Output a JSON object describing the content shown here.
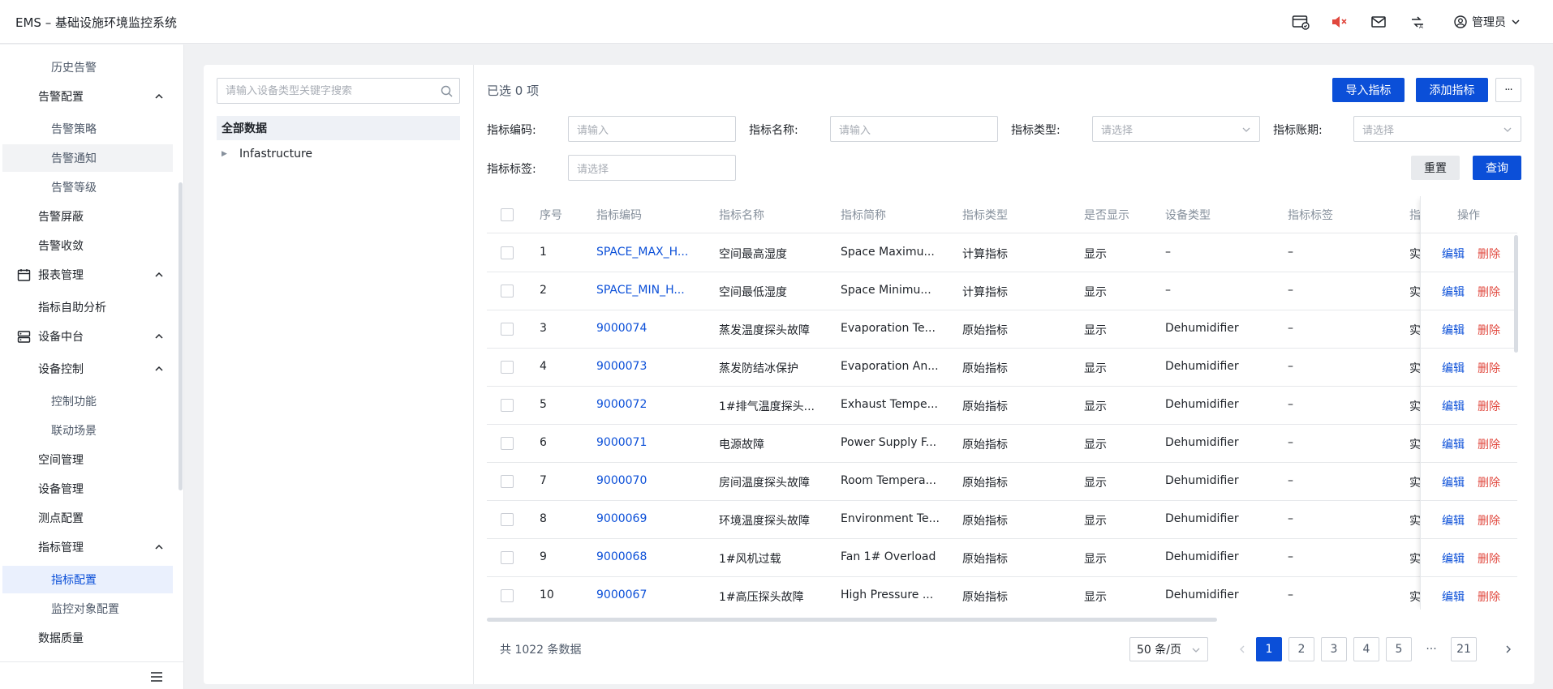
{
  "app": {
    "title": "EMS – 基础设施环境监控系统"
  },
  "header": {
    "user_name": "管理员"
  },
  "sidebar": {
    "items": [
      {
        "label": "历史告警"
      },
      {
        "label": "告警配置"
      },
      {
        "label": "告警策略"
      },
      {
        "label": "告警通知"
      },
      {
        "label": "告警等级"
      },
      {
        "label": "告警屏蔽"
      },
      {
        "label": "告警收敛"
      },
      {
        "label": "报表管理"
      },
      {
        "label": "指标自助分析"
      },
      {
        "label": "设备中台"
      },
      {
        "label": "设备控制"
      },
      {
        "label": "控制功能"
      },
      {
        "label": "联动场景"
      },
      {
        "label": "空间管理"
      },
      {
        "label": "设备管理"
      },
      {
        "label": "测点配置"
      },
      {
        "label": "指标管理"
      },
      {
        "label": "指标配置"
      },
      {
        "label": "监控对象配置"
      },
      {
        "label": "数据质量"
      }
    ]
  },
  "tree": {
    "search_placeholder": "请输入设备类型关键字搜索",
    "all_label": "全部数据",
    "nodes": [
      {
        "label": "Infastructure"
      }
    ]
  },
  "toolbar": {
    "selected_text": "已选 0 项",
    "import_label": "导入指标",
    "add_label": "添加指标",
    "more_label": "···"
  },
  "filters": {
    "code_label": "指标编码:",
    "code_placeholder": "请输入",
    "name_label": "指标名称:",
    "name_placeholder": "请输入",
    "type_label": "指标类型:",
    "type_placeholder": "请选择",
    "period_label": "指标账期:",
    "period_placeholder": "请选择",
    "tag_label": "指标标签:",
    "tag_placeholder": "请选择",
    "reset_label": "重置",
    "query_label": "查询"
  },
  "table": {
    "headers": [
      "序号",
      "指标编码",
      "指标名称",
      "指标简称",
      "指标类型",
      "是否显示",
      "设备类型",
      "指标标签",
      "指",
      "操作"
    ],
    "edit_label": "编辑",
    "delete_label": "删除",
    "rows": [
      {
        "no": "1",
        "code": "SPACE_MAX_H...",
        "name": "空间最高湿度",
        "short": "Space Maximu...",
        "type": "计算指标",
        "show": "显示",
        "device": "–",
        "tag": "–",
        "extra": "实"
      },
      {
        "no": "2",
        "code": "SPACE_MIN_H...",
        "name": "空间最低湿度",
        "short": "Space Minimu...",
        "type": "计算指标",
        "show": "显示",
        "device": "–",
        "tag": "–",
        "extra": "实"
      },
      {
        "no": "3",
        "code": "9000074",
        "name": "蒸发温度探头故障",
        "short": "Evaporation Te...",
        "type": "原始指标",
        "show": "显示",
        "device": "Dehumidifier",
        "tag": "–",
        "extra": "实"
      },
      {
        "no": "4",
        "code": "9000073",
        "name": "蒸发防结冰保护",
        "short": "Evaporation An...",
        "type": "原始指标",
        "show": "显示",
        "device": "Dehumidifier",
        "tag": "–",
        "extra": "实"
      },
      {
        "no": "5",
        "code": "9000072",
        "name": "1#排气温度探头...",
        "short": "Exhaust Tempe...",
        "type": "原始指标",
        "show": "显示",
        "device": "Dehumidifier",
        "tag": "–",
        "extra": "实"
      },
      {
        "no": "6",
        "code": "9000071",
        "name": "电源故障",
        "short": "Power Supply F...",
        "type": "原始指标",
        "show": "显示",
        "device": "Dehumidifier",
        "tag": "–",
        "extra": "实"
      },
      {
        "no": "7",
        "code": "9000070",
        "name": "房间温度探头故障",
        "short": "Room Tempera...",
        "type": "原始指标",
        "show": "显示",
        "device": "Dehumidifier",
        "tag": "–",
        "extra": "实"
      },
      {
        "no": "8",
        "code": "9000069",
        "name": "环境温度探头故障",
        "short": "Environment Te...",
        "type": "原始指标",
        "show": "显示",
        "device": "Dehumidifier",
        "tag": "–",
        "extra": "实"
      },
      {
        "no": "9",
        "code": "9000068",
        "name": "1#风机过载",
        "short": "Fan 1# Overload",
        "type": "原始指标",
        "show": "显示",
        "device": "Dehumidifier",
        "tag": "–",
        "extra": "实"
      },
      {
        "no": "10",
        "code": "9000067",
        "name": "1#高压探头故障",
        "short": "High Pressure ...",
        "type": "原始指标",
        "show": "显示",
        "device": "Dehumidifier",
        "tag": "–",
        "extra": "实"
      }
    ]
  },
  "pagination": {
    "total_text": "共 1022 条数据",
    "page_size": "50 条/页",
    "pages": [
      "1",
      "2",
      "3",
      "4",
      "5",
      "···",
      "21"
    ],
    "current": "1"
  },
  "colors": {
    "accent": "#0b4fd8",
    "danger": "#e0473d",
    "active_bg": "#eaf0fd"
  }
}
